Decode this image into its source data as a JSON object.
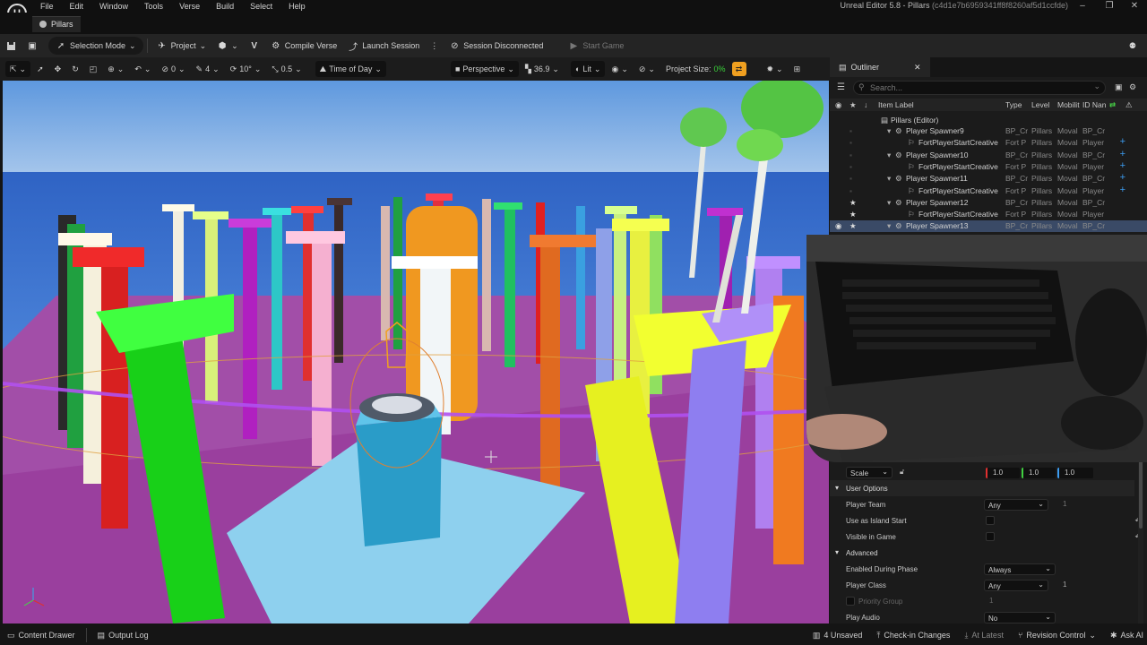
{
  "window": {
    "title": "Unreal Editor 5.8 - Pillars",
    "hash": "(c4d1e7b6959341ff8f8260af5d1ccfde)",
    "minimize": "–",
    "maximize": "❐",
    "close": "✕"
  },
  "menu": [
    "File",
    "Edit",
    "Window",
    "Tools",
    "Verse",
    "Build",
    "Select",
    "Help"
  ],
  "doc_tab": "Pillars",
  "toolbar": {
    "mode": "Selection Mode",
    "project": "Project",
    "compile": "Compile Verse",
    "launch": "Launch Session",
    "session": "Session Disconnected",
    "start": "Start Game"
  },
  "viewport_toolbar": {
    "snap_rot": "0",
    "grid": "4",
    "rot_angle": "10°",
    "scale_snap": "0.5",
    "time_of_day": "Time of Day",
    "perspective": "Perspective",
    "fov": "36.9",
    "lit": "Lit",
    "project_size_label": "Project Size:",
    "project_size_value": "0%"
  },
  "outliner": {
    "tab": "Outliner",
    "search_placeholder": "Search...",
    "columns": {
      "label": "Item Label",
      "type": "Type",
      "level": "Level",
      "mobility": "Mobilit",
      "id": "ID Nan"
    },
    "root": "Pillars (Editor)",
    "rows": [
      {
        "label": "Player Spawner9",
        "type": "BP_Cr",
        "level": "Pillars",
        "mob": "Moval",
        "id": "BP_Cr",
        "indent": 1,
        "star": false,
        "plus": false
      },
      {
        "label": "FortPlayerStartCreative",
        "type": "Fort P",
        "level": "Pillars",
        "mob": "Moval",
        "id": "Player",
        "indent": 2,
        "star": false,
        "plus": true
      },
      {
        "label": "Player Spawner10",
        "type": "BP_Cr",
        "level": "Pillars",
        "mob": "Moval",
        "id": "BP_Cr",
        "indent": 1,
        "star": false,
        "plus": true
      },
      {
        "label": "FortPlayerStartCreative",
        "type": "Fort P",
        "level": "Pillars",
        "mob": "Moval",
        "id": "Player",
        "indent": 2,
        "star": false,
        "plus": true
      },
      {
        "label": "Player Spawner11",
        "type": "BP_Cr",
        "level": "Pillars",
        "mob": "Moval",
        "id": "BP_Cr",
        "indent": 1,
        "star": false,
        "plus": true
      },
      {
        "label": "FortPlayerStartCreative",
        "type": "Fort P",
        "level": "Pillars",
        "mob": "Moval",
        "id": "Player",
        "indent": 2,
        "star": false,
        "plus": true
      },
      {
        "label": "Player Spawner12",
        "type": "BP_Cr",
        "level": "Pillars",
        "mob": "Moval",
        "id": "BP_Cr",
        "indent": 1,
        "star": true,
        "plus": false
      },
      {
        "label": "FortPlayerStartCreative",
        "type": "Fort P",
        "level": "Pillars",
        "mob": "Moval",
        "id": "Player",
        "indent": 2,
        "star": true,
        "plus": false
      },
      {
        "label": "Player Spawner13",
        "type": "BP_Cr",
        "level": "Pillars",
        "mob": "Moval",
        "id": "BP_Cr",
        "indent": 1,
        "star": true,
        "plus": false,
        "selected": true
      }
    ]
  },
  "details": {
    "scale_label": "Scale",
    "scale_x": "1.0",
    "scale_y": "1.0",
    "scale_z": "1.0",
    "user_options": "User Options",
    "player_team": "Player Team",
    "player_team_value": "Any",
    "player_team_num": "1",
    "island_start": "Use as Island Start",
    "visible_in_game": "Visible in Game",
    "advanced": "Advanced",
    "enabled_phase": "Enabled During Phase",
    "enabled_phase_value": "Always",
    "player_class": "Player Class",
    "player_class_value": "Any",
    "player_class_num": "1",
    "priority_group": "Priority Group",
    "priority_group_num": "1",
    "play_audio": "Play Audio",
    "play_audio_value": "No"
  },
  "statusbar": {
    "content_drawer": "Content Drawer",
    "output_log": "Output Log",
    "unsaved": "4 Unsaved",
    "checkin": "Check-in Changes",
    "at_latest": "At Latest",
    "revision": "Revision Control",
    "ask_ai": "Ask AI"
  },
  "colors": {
    "accent_blue": "#3c9cf0",
    "selection_row": "#3a4a66",
    "project_size_green": "#3ad13a",
    "panel": "#1b1b1b"
  }
}
